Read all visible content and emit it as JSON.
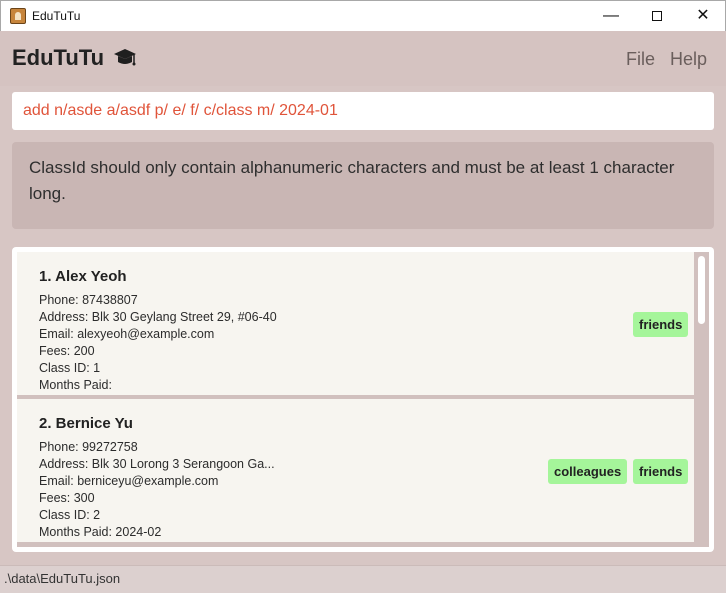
{
  "window": {
    "title": "EduTuTu",
    "icon": "app-icon",
    "min_glyph": "—",
    "close_glyph": "✕"
  },
  "header": {
    "brand": "EduTuTu",
    "brand_icon": "graduation-cap-icon",
    "menus": [
      "File",
      "Help"
    ]
  },
  "command": {
    "value": "add n/asde a/asdf p/ e/ f/ c/class m/ 2024-01"
  },
  "result": {
    "message": "ClassId should only contain alphanumeric characters and must be at least 1 character long."
  },
  "persons": [
    {
      "name": "1.  Alex Yeoh",
      "phone": "Phone:  87438807",
      "address": "Address:  Blk 30 Geylang Street 29, #06-40",
      "email": "Email:  alexyeoh@example.com",
      "fees": "Fees:  200",
      "class_id": "Class ID:  1",
      "months_paid": "Months Paid:",
      "tags": [
        "friends"
      ]
    },
    {
      "name": "2.  Bernice Yu",
      "phone": "Phone:  99272758",
      "address": "Address:  Blk 30 Lorong 3 Serangoon Ga...",
      "email": "Email:  berniceyu@example.com",
      "fees": "Fees:  300",
      "class_id": "Class ID:  2",
      "months_paid": "Months Paid:  2024-02",
      "tags": [
        "colleagues",
        "friends"
      ]
    }
  ],
  "status": {
    "path": ".\\data\\EduTuTu.json"
  },
  "colors": {
    "background": "#d7c6c4",
    "tag": "#a5f59a",
    "command_text": "#e0543a",
    "card": "#f7f5f0"
  }
}
